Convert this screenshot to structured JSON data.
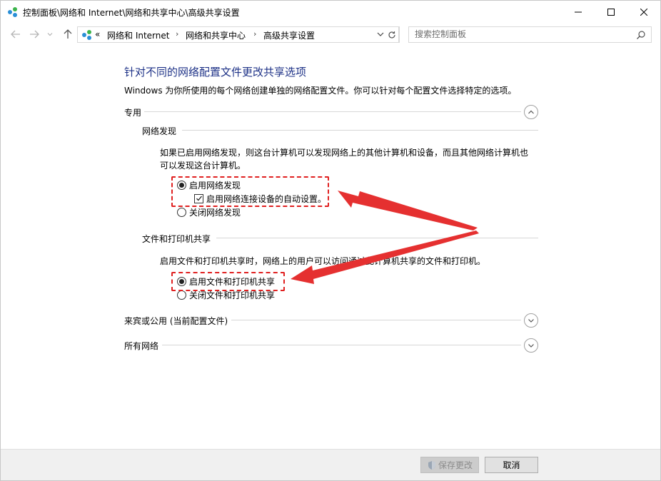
{
  "window": {
    "title": "控制面板\\网络和 Internet\\网络和共享中心\\高级共享设置",
    "controls": {
      "minimize": "minimize-icon",
      "maximize": "maximize-icon",
      "close": "close-icon"
    }
  },
  "nav": {
    "overflow": "«",
    "breadcrumbs": [
      "网络和 Internet",
      "网络和共享中心",
      "高级共享设置"
    ],
    "separator": "›",
    "search_placeholder": "搜索控制面板"
  },
  "main": {
    "title": "针对不同的网络配置文件更改共享选项",
    "description": "Windows 为你所使用的每个网络创建单独的网络配置文件。你可以针对每个配置文件选择特定的选项。",
    "profiles": [
      {
        "label": "专用",
        "expanded": true,
        "groups": [
          {
            "label": "网络发现",
            "description_line1": "如果已启用网络发现，则这台计算机可以发现网络上的其他计算机和设备，而且其他网络计算机也",
            "description_line2": "可以发现这台计算机。",
            "options": [
              {
                "label": "启用网络发现",
                "selected": true
              },
              {
                "label": "关闭网络发现",
                "selected": false
              }
            ],
            "sub_option": {
              "label": "启用网络连接设备的自动设置。",
              "checked": true
            }
          },
          {
            "label": "文件和打印机共享",
            "description": "启用文件和打印机共享时，网络上的用户可以访问通过此计算机共享的文件和打印机。",
            "options": [
              {
                "label": "启用文件和打印机共享",
                "selected": true
              },
              {
                "label": "关闭文件和打印机共享",
                "selected": false
              }
            ]
          }
        ]
      },
      {
        "label": "来宾或公用 (当前配置文件)",
        "expanded": false
      },
      {
        "label": "所有网络",
        "expanded": false
      }
    ]
  },
  "footer": {
    "save_label": "保存更改",
    "cancel_label": "取消"
  },
  "colors": {
    "title_blue": "#1e3287",
    "annotation_red": "#e02020",
    "footer_bg": "#f0f0f0"
  }
}
